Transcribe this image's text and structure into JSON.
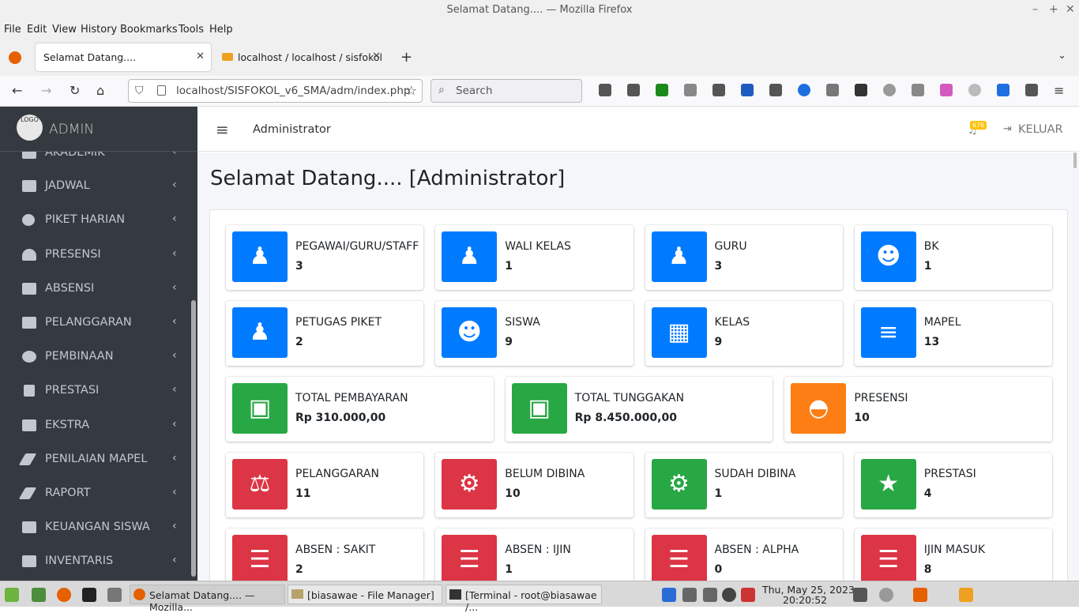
{
  "window": {
    "title": "Selamat Datang.... — Mozilla Firefox"
  },
  "menu": [
    "File",
    "Edit",
    "View",
    "History",
    "Bookmarks",
    "Tools",
    "Help"
  ],
  "tabs": [
    {
      "label": "Selamat Datang...."
    },
    {
      "label": "localhost / localhost / sisfokol"
    }
  ],
  "nav": {
    "url": "localhost/SISFOKOL_v6_SMA/adm/index.php",
    "search_placeholder": "Search"
  },
  "sidebar": {
    "brand_logo": "LOGO",
    "brand": "ADMIN",
    "items": [
      {
        "label": "AKADEMIK",
        "icon": "book-icon"
      },
      {
        "label": "JADWAL",
        "icon": "list-icon"
      },
      {
        "label": "PIKET HARIAN",
        "icon": "clock-icon"
      },
      {
        "label": "PRESENSI",
        "icon": "gauge-icon"
      },
      {
        "label": "ABSENSI",
        "icon": "newspaper-icon"
      },
      {
        "label": "PELANGGARAN",
        "icon": "scale-icon"
      },
      {
        "label": "PEMBINAAN",
        "icon": "cogs-icon"
      },
      {
        "label": "PRESTASI",
        "icon": "trophy-icon"
      },
      {
        "label": "EKSTRA",
        "icon": "briefcase-icon"
      },
      {
        "label": "PENILAIAN MAPEL",
        "icon": "pencil-icon"
      },
      {
        "label": "RAPORT",
        "icon": "pencil-icon"
      },
      {
        "label": "KEUANGAN SISWA",
        "icon": "money-icon"
      },
      {
        "label": "INVENTARIS",
        "icon": "archive-icon"
      }
    ]
  },
  "header": {
    "role": "Administrator",
    "notif_count": "676",
    "logout": "KELUAR"
  },
  "page": {
    "title": "Selamat Datang.... [Administrator]"
  },
  "colors": {
    "blue": "#007bff",
    "green": "#28a745",
    "orange": "#fd7e14",
    "red": "#dc3545"
  },
  "boxes": [
    [
      {
        "label": "PEGAWAI/GURU/STAFF",
        "value": "3",
        "color": "#007bff",
        "icon": "user-secret-icon"
      },
      {
        "label": "WALI KELAS",
        "value": "1",
        "color": "#007bff",
        "icon": "user-secret-icon"
      },
      {
        "label": "GURU",
        "value": "3",
        "color": "#007bff",
        "icon": "user-secret-icon"
      },
      {
        "label": "BK",
        "value": "1",
        "color": "#007bff",
        "icon": "users-icon"
      }
    ],
    [
      {
        "label": "PETUGAS PIKET",
        "value": "2",
        "color": "#007bff",
        "icon": "user-secret-icon"
      },
      {
        "label": "SISWA",
        "value": "9",
        "color": "#007bff",
        "icon": "users-icon"
      },
      {
        "label": "KELAS",
        "value": "9",
        "color": "#007bff",
        "icon": "building-icon"
      },
      {
        "label": "MAPEL",
        "value": "13",
        "color": "#007bff",
        "icon": "book-icon"
      }
    ],
    [
      {
        "label": "TOTAL PEMBAYARAN",
        "value": "Rp 310.000,00",
        "color": "#28a745",
        "icon": "money-icon"
      },
      {
        "label": "TOTAL TUNGGAKAN",
        "value": "Rp 8.450.000,00",
        "color": "#28a745",
        "icon": "money-icon"
      },
      {
        "label": "PRESENSI",
        "value": "10",
        "color": "#fd7e14",
        "icon": "gauge-icon"
      }
    ],
    [
      {
        "label": "PELANGGARAN",
        "value": "11",
        "color": "#dc3545",
        "icon": "scale-icon"
      },
      {
        "label": "BELUM DIBINA",
        "value": "10",
        "color": "#dc3545",
        "icon": "cogs-icon"
      },
      {
        "label": "SUDAH DIBINA",
        "value": "1",
        "color": "#28a745",
        "icon": "cogs-icon"
      },
      {
        "label": "PRESTASI",
        "value": "4",
        "color": "#28a745",
        "icon": "trophy-icon"
      }
    ],
    [
      {
        "label": "ABSEN : SAKIT",
        "value": "2",
        "color": "#dc3545",
        "icon": "server-icon"
      },
      {
        "label": "ABSEN : IJIN",
        "value": "1",
        "color": "#dc3545",
        "icon": "server-icon"
      },
      {
        "label": "ABSEN : ALPHA",
        "value": "0",
        "color": "#dc3545",
        "icon": "server-icon"
      },
      {
        "label": "IJIN MASUK",
        "value": "8",
        "color": "#dc3545",
        "icon": "server-icon"
      }
    ]
  ],
  "taskbar": {
    "items": [
      "Selamat Datang.... — Mozilla...",
      "[biasawae - File Manager]",
      "[Terminal - root@biasawae /..."
    ],
    "date": "Thu, May 25, 2023",
    "time": "20:20:52"
  }
}
